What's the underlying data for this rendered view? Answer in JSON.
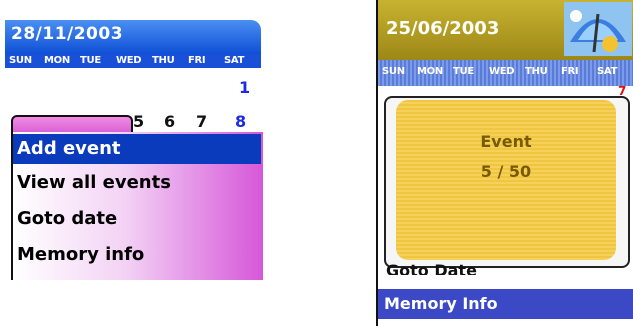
{
  "left_screen": {
    "date": "28/11/2003",
    "weekdays": [
      "SUN",
      "MON",
      "TUE",
      "WED",
      "THU",
      "FRI",
      "SAT"
    ],
    "calendar_first_row": [
      "1"
    ],
    "calendar_visible_row": [
      "5",
      "6",
      "7",
      "8"
    ],
    "menu": {
      "items": [
        "Add event",
        "View all events",
        "Goto date",
        "Memory info"
      ],
      "selected": "Add event"
    },
    "colors": {
      "title_bar": "#0f4fd6",
      "selection": "#0b3bbd",
      "menu_gradient_end": "#d657d9"
    }
  },
  "right_screen": {
    "date": "25/06/2003",
    "weekdays": [
      "SUN",
      "MON",
      "TUE",
      "WED",
      "THU",
      "FRI",
      "SAT"
    ],
    "corner_day": "7",
    "popup": {
      "title": "Event",
      "count": "5 / 50"
    },
    "partial_item": "Goto Date",
    "selected_item": "Memory Info",
    "logo_icon": "umbrella-icon",
    "colors": {
      "title_bar": "#9d8716",
      "selection": "#3b49c6",
      "popup_card": "#f0c640"
    }
  }
}
